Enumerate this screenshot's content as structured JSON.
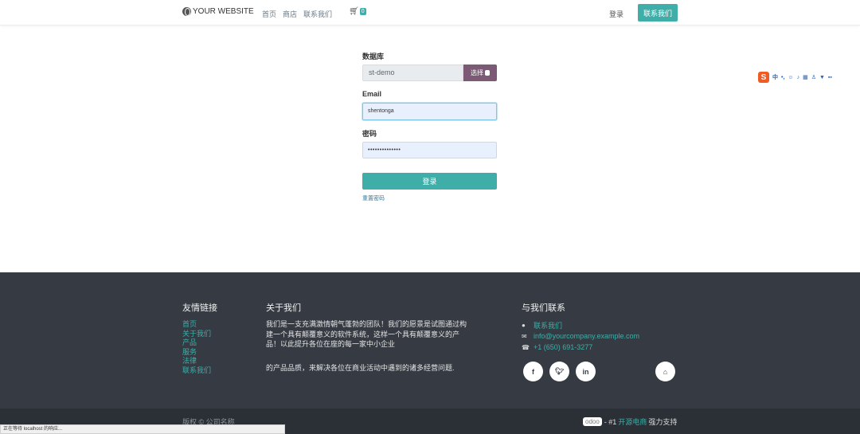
{
  "header": {
    "brand": "YOUR WEBSITE",
    "nav": [
      "首页",
      "商店",
      "联系我们"
    ],
    "cart_count": "0",
    "login": "登录",
    "contact_button": "联系我们"
  },
  "login_form": {
    "database_label": "数据库",
    "database_value": "st-demo",
    "select_button": "选择",
    "email_label": "Email",
    "email_value": "shentonga",
    "password_label": "密码",
    "password_mask": "••••••••••••••",
    "submit_label": "登录",
    "reset_link": "重置密码"
  },
  "footer": {
    "links_heading": "友情链接",
    "links": [
      "首页",
      "关于我们",
      "产品",
      "服务",
      "法律",
      "联系我们"
    ],
    "about_heading": "关于我们",
    "about_text": "我们是一支充满激情朝气蓬勃的团队！我们的愿景是试图通过构建一个具有颠覆意义的软件系统，这样一个具有颠覆意义的产品！以此提升各位在座的每一家中小企业",
    "about_text2": "的产品品质，来解决各位在商业活动中遇到的诸多经营问题.",
    "contact_heading": "与我们联系",
    "contact_us": "联系我们",
    "email": "info@yourcompany.example.com",
    "phone": "+1 (650) 691-3277",
    "copyright": "版权 © 公司名称",
    "odoo_logo": "odoo",
    "powered_prefix": "- #1",
    "powered_link": "开源电商",
    "powered_suffix": "强力支持"
  },
  "status_bar": "正在等待 localhost 的响应..."
}
